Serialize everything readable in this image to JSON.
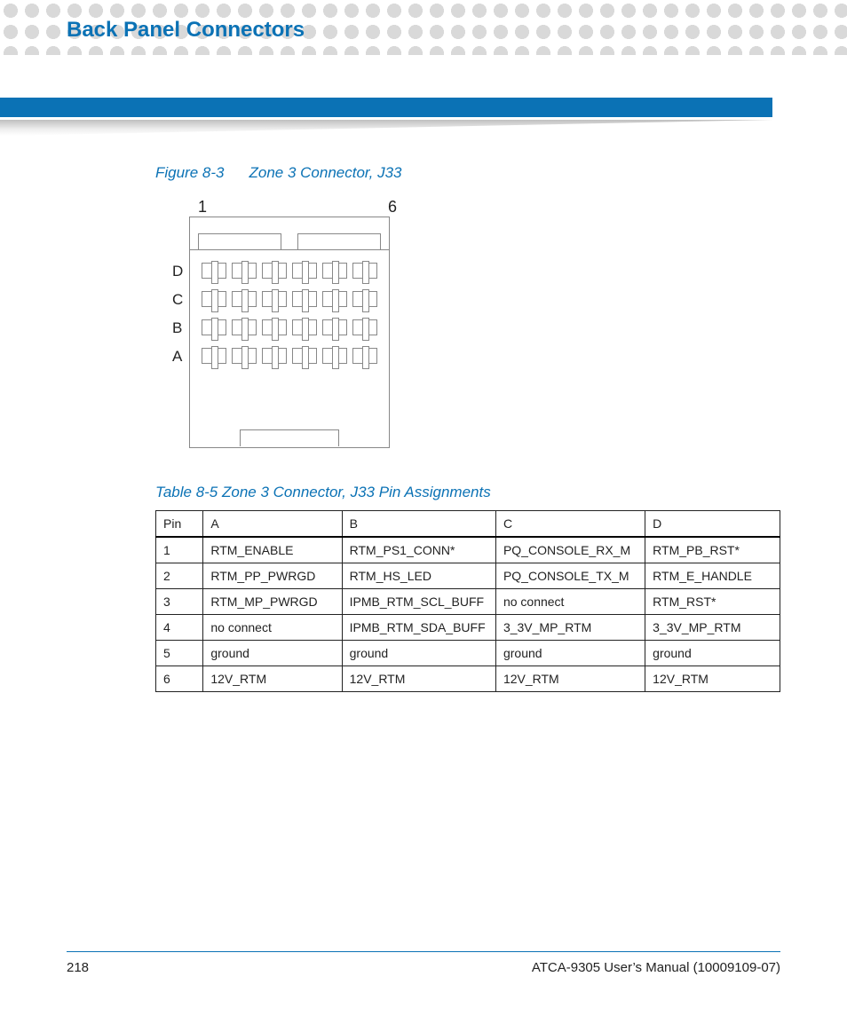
{
  "header": {
    "section_title": "Back Panel Connectors"
  },
  "figure": {
    "label": "Figure 8-3",
    "title": "Zone 3 Connector, J33",
    "col_first": "1",
    "col_last": "6",
    "rows": [
      "D",
      "C",
      "B",
      "A"
    ]
  },
  "table": {
    "label": "Table 8-5",
    "title": "Zone 3 Connector, J33 Pin Assignments",
    "headers": [
      "Pin",
      "A",
      "B",
      "C",
      "D"
    ],
    "rows": [
      {
        "pin": "1",
        "A": "RTM_ENABLE",
        "B": "RTM_PS1_CONN*",
        "C": "PQ_CONSOLE_RX_M",
        "D": "RTM_PB_RST*"
      },
      {
        "pin": "2",
        "A": "RTM_PP_PWRGD",
        "B": "RTM_HS_LED",
        "C": "PQ_CONSOLE_TX_M",
        "D": "RTM_E_HANDLE"
      },
      {
        "pin": "3",
        "A": "RTM_MP_PWRGD",
        "B": "IPMB_RTM_SCL_BUFF",
        "C": "no connect",
        "D": "RTM_RST*"
      },
      {
        "pin": "4",
        "A": "no connect",
        "B": "IPMB_RTM_SDA_BUFF",
        "C": "3_3V_MP_RTM",
        "D": "3_3V_MP_RTM"
      },
      {
        "pin": "5",
        "A": "ground",
        "B": "ground",
        "C": "ground",
        "D": "ground"
      },
      {
        "pin": "6",
        "A": "12V_RTM",
        "B": "12V_RTM",
        "C": "12V_RTM",
        "D": "12V_RTM"
      }
    ]
  },
  "footer": {
    "page_number": "218",
    "doc_title": "ATCA-9305 User’s Manual (10009109-07)"
  }
}
